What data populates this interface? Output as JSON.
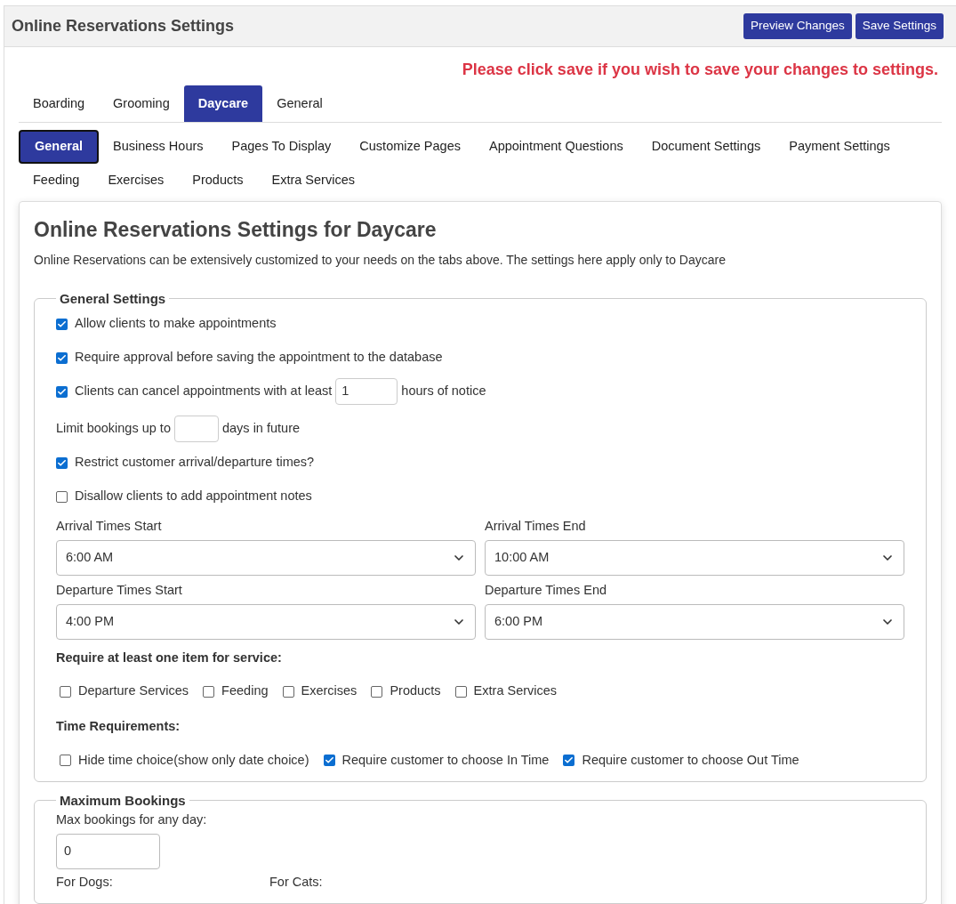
{
  "header": {
    "title": "Online Reservations Settings",
    "buttons": [
      "Preview Changes",
      "Save Settings"
    ]
  },
  "notice": "Please click save if you wish to save your changes to settings.",
  "tabs": [
    {
      "label": "Boarding",
      "selected": false
    },
    {
      "label": "Grooming",
      "selected": false
    },
    {
      "label": "Daycare",
      "selected": true
    },
    {
      "label": "General",
      "selected": false
    }
  ],
  "subtabs": [
    {
      "label": "General",
      "selected": true
    },
    {
      "label": "Business Hours",
      "selected": false
    },
    {
      "label": "Pages To Display",
      "selected": false
    },
    {
      "label": "Customize Pages",
      "selected": false
    },
    {
      "label": "Appointment Questions",
      "selected": false
    },
    {
      "label": "Document Settings",
      "selected": false
    },
    {
      "label": "Payment Settings",
      "selected": false
    },
    {
      "label": "Feeding",
      "selected": false
    },
    {
      "label": "Exercises",
      "selected": false
    },
    {
      "label": "Products",
      "selected": false
    },
    {
      "label": "Extra Services",
      "selected": false
    }
  ],
  "panel": {
    "title": "Online Reservations Settings for Daycare",
    "description": "Online Reservations can be extensively customized to your needs on the tabs above. The settings here apply only to Daycare"
  },
  "general_settings": {
    "legend": "General Settings",
    "rows": [
      {
        "kind": "checkbox",
        "checked": true,
        "label": "Allow clients to make appointments"
      },
      {
        "kind": "checkbox",
        "checked": true,
        "label": "Require approval before saving the appointment to the database"
      },
      {
        "kind": "checkbox-input",
        "checked": true,
        "label": "Clients can cancel appointments with at least",
        "value": "1",
        "suffix": "hours of notice"
      },
      {
        "kind": "input",
        "label": "Limit bookings up to",
        "suffix": "days in future"
      },
      {
        "kind": "checkbox",
        "checked": true,
        "label": "Restrict customer arrival/departure times?"
      },
      {
        "kind": "checkbox",
        "checked": false,
        "label": "Disallow clients to add appointment notes"
      }
    ],
    "selects": [
      {
        "label": "Arrival Times Start",
        "value": "6:00 AM"
      },
      {
        "label": "Arrival Times End",
        "value": "10:00 AM"
      },
      {
        "label": "Departure Times Start",
        "value": "4:00 PM"
      },
      {
        "label": "Departure Times End",
        "value": "6:00 PM"
      }
    ],
    "service_heading": "Require at least one item for service:",
    "services": [
      {
        "label": "Departure Services",
        "checked": false
      },
      {
        "label": "Feeding",
        "checked": false
      },
      {
        "label": "Exercises",
        "checked": false
      },
      {
        "label": "Products",
        "checked": false
      },
      {
        "label": "Extra Services",
        "checked": false
      }
    ],
    "time_heading": "Time Requirements:",
    "time_requirements": [
      {
        "label": "Hide time choice(show only date choice)",
        "checked": false
      },
      {
        "label": "Require customer to choose In Time",
        "checked": true
      },
      {
        "label": "Require customer to choose Out Time",
        "checked": true
      }
    ]
  },
  "maximum_bookings": {
    "legend": "Maximum Bookings",
    "label": "Max bookings for any day:",
    "value": "0",
    "columns": [
      "For Dogs:",
      "For Cats:"
    ]
  }
}
